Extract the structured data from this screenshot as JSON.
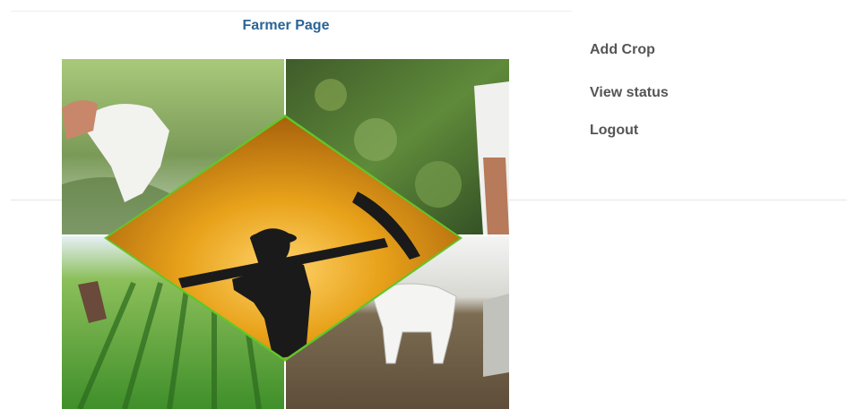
{
  "header": {
    "title": "Farmer Page"
  },
  "nav": {
    "items": [
      {
        "label": "Add Crop"
      },
      {
        "label": "View status"
      },
      {
        "label": "Logout"
      }
    ]
  },
  "collage": {
    "icon": "farmer-collage-image",
    "colors": {
      "border_green": "#5fc72a",
      "sunset_orange": "#e39a12",
      "field_green": "#3f8f2a",
      "soil_brown": "#6b5a44"
    }
  }
}
